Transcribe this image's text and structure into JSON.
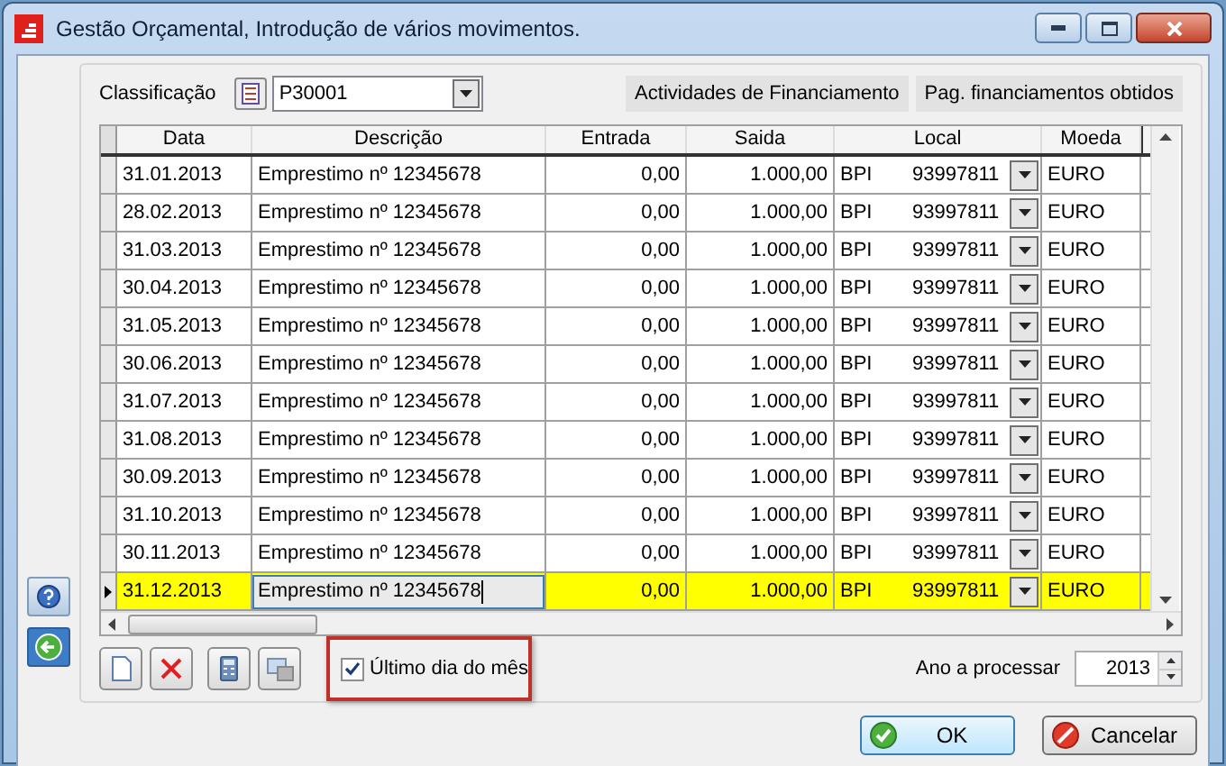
{
  "window": {
    "title": "Gestão Orçamental, Introdução de vários movimentos."
  },
  "classification": {
    "label": "Classificação",
    "value": "P30001",
    "info": [
      "Actividades de Financiamento",
      "Pag. financiamentos obtidos"
    ]
  },
  "table": {
    "columns": [
      "Data",
      "Descrição",
      "Entrada",
      "Saida",
      "Local",
      "Moeda"
    ],
    "rows": [
      {
        "date": "31.01.2013",
        "description": "Emprestimo nº 12345678",
        "entrada": "0,00",
        "saida": "1.000,00",
        "bank": "BPI",
        "account": "93997811",
        "currency": "EURO",
        "selected": false
      },
      {
        "date": "28.02.2013",
        "description": "Emprestimo nº 12345678",
        "entrada": "0,00",
        "saida": "1.000,00",
        "bank": "BPI",
        "account": "93997811",
        "currency": "EURO",
        "selected": false
      },
      {
        "date": "31.03.2013",
        "description": "Emprestimo nº 12345678",
        "entrada": "0,00",
        "saida": "1.000,00",
        "bank": "BPI",
        "account": "93997811",
        "currency": "EURO",
        "selected": false
      },
      {
        "date": "30.04.2013",
        "description": "Emprestimo nº 12345678",
        "entrada": "0,00",
        "saida": "1.000,00",
        "bank": "BPI",
        "account": "93997811",
        "currency": "EURO",
        "selected": false
      },
      {
        "date": "31.05.2013",
        "description": "Emprestimo nº 12345678",
        "entrada": "0,00",
        "saida": "1.000,00",
        "bank": "BPI",
        "account": "93997811",
        "currency": "EURO",
        "selected": false
      },
      {
        "date": "30.06.2013",
        "description": "Emprestimo nº 12345678",
        "entrada": "0,00",
        "saida": "1.000,00",
        "bank": "BPI",
        "account": "93997811",
        "currency": "EURO",
        "selected": false
      },
      {
        "date": "31.07.2013",
        "description": "Emprestimo nº 12345678",
        "entrada": "0,00",
        "saida": "1.000,00",
        "bank": "BPI",
        "account": "93997811",
        "currency": "EURO",
        "selected": false
      },
      {
        "date": "31.08.2013",
        "description": "Emprestimo nº 12345678",
        "entrada": "0,00",
        "saida": "1.000,00",
        "bank": "BPI",
        "account": "93997811",
        "currency": "EURO",
        "selected": false
      },
      {
        "date": "30.09.2013",
        "description": "Emprestimo nº 12345678",
        "entrada": "0,00",
        "saida": "1.000,00",
        "bank": "BPI",
        "account": "93997811",
        "currency": "EURO",
        "selected": false
      },
      {
        "date": "31.10.2013",
        "description": "Emprestimo nº 12345678",
        "entrada": "0,00",
        "saida": "1.000,00",
        "bank": "BPI",
        "account": "93997811",
        "currency": "EURO",
        "selected": false
      },
      {
        "date": "30.11.2013",
        "description": "Emprestimo nº 12345678",
        "entrada": "0,00",
        "saida": "1.000,00",
        "bank": "BPI",
        "account": "93997811",
        "currency": "EURO",
        "selected": false
      },
      {
        "date": "31.12.2013",
        "description": "Emprestimo nº 12345678",
        "entrada": "0,00",
        "saida": "1.000,00",
        "bank": "BPI",
        "account": "93997811",
        "currency": "EURO",
        "selected": true
      }
    ]
  },
  "last_day_checkbox": {
    "label": "Último dia do mês",
    "checked": true,
    "highlighted": true
  },
  "year": {
    "label": "Ano a processar",
    "value": "2013"
  },
  "buttons": [
    {
      "label": "OK",
      "kind": "ok"
    },
    {
      "label": "Cancelar",
      "kind": "cancel"
    }
  ]
}
